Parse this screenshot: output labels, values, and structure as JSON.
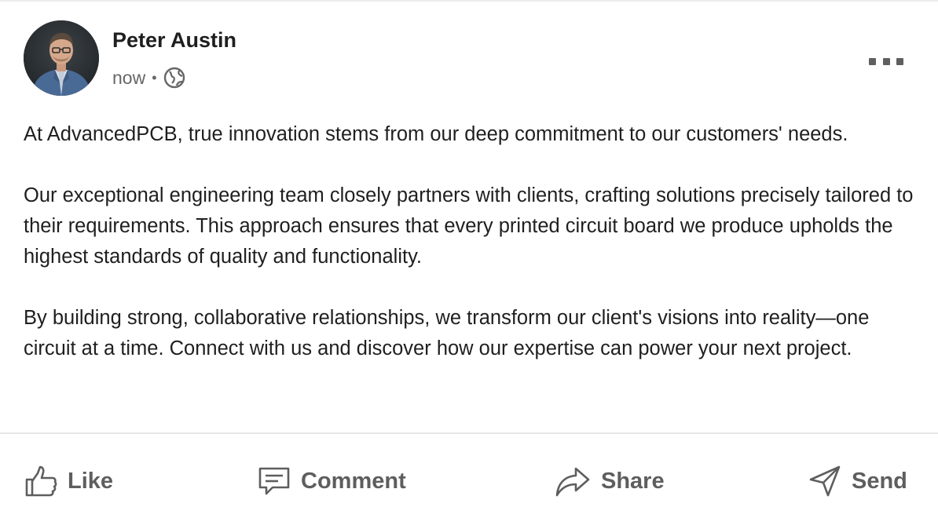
{
  "post": {
    "author": {
      "name": "Peter Austin",
      "avatar_icon": "person-portrait-icon"
    },
    "meta": {
      "timestamp": "now",
      "separator": "•",
      "visibility_icon": "globe-icon"
    },
    "menu_icon": "more-options-icon",
    "body": {
      "paragraphs": [
        "At AdvancedPCB, true innovation stems from our deep commitment to our customers' needs.",
        "Our exceptional engineering team closely partners with clients, crafting solutions precisely tailored to their requirements. This approach ensures that every printed circuit board we produce upholds the highest standards of quality and functionality.",
        "By building strong, collaborative relationships, we transform our client's visions into reality—one circuit at a time. Connect with us and discover how our expertise can power your next project."
      ]
    },
    "actions": [
      {
        "label": "Like",
        "icon": "thumbs-up-icon"
      },
      {
        "label": "Comment",
        "icon": "comment-icon"
      },
      {
        "label": "Share",
        "icon": "share-arrow-icon"
      },
      {
        "label": "Send",
        "icon": "send-icon"
      }
    ]
  },
  "colors": {
    "text_primary": "#1f1f1f",
    "text_secondary": "#666666",
    "action_text": "#5e5e5e",
    "divider": "#e6e6e6"
  }
}
